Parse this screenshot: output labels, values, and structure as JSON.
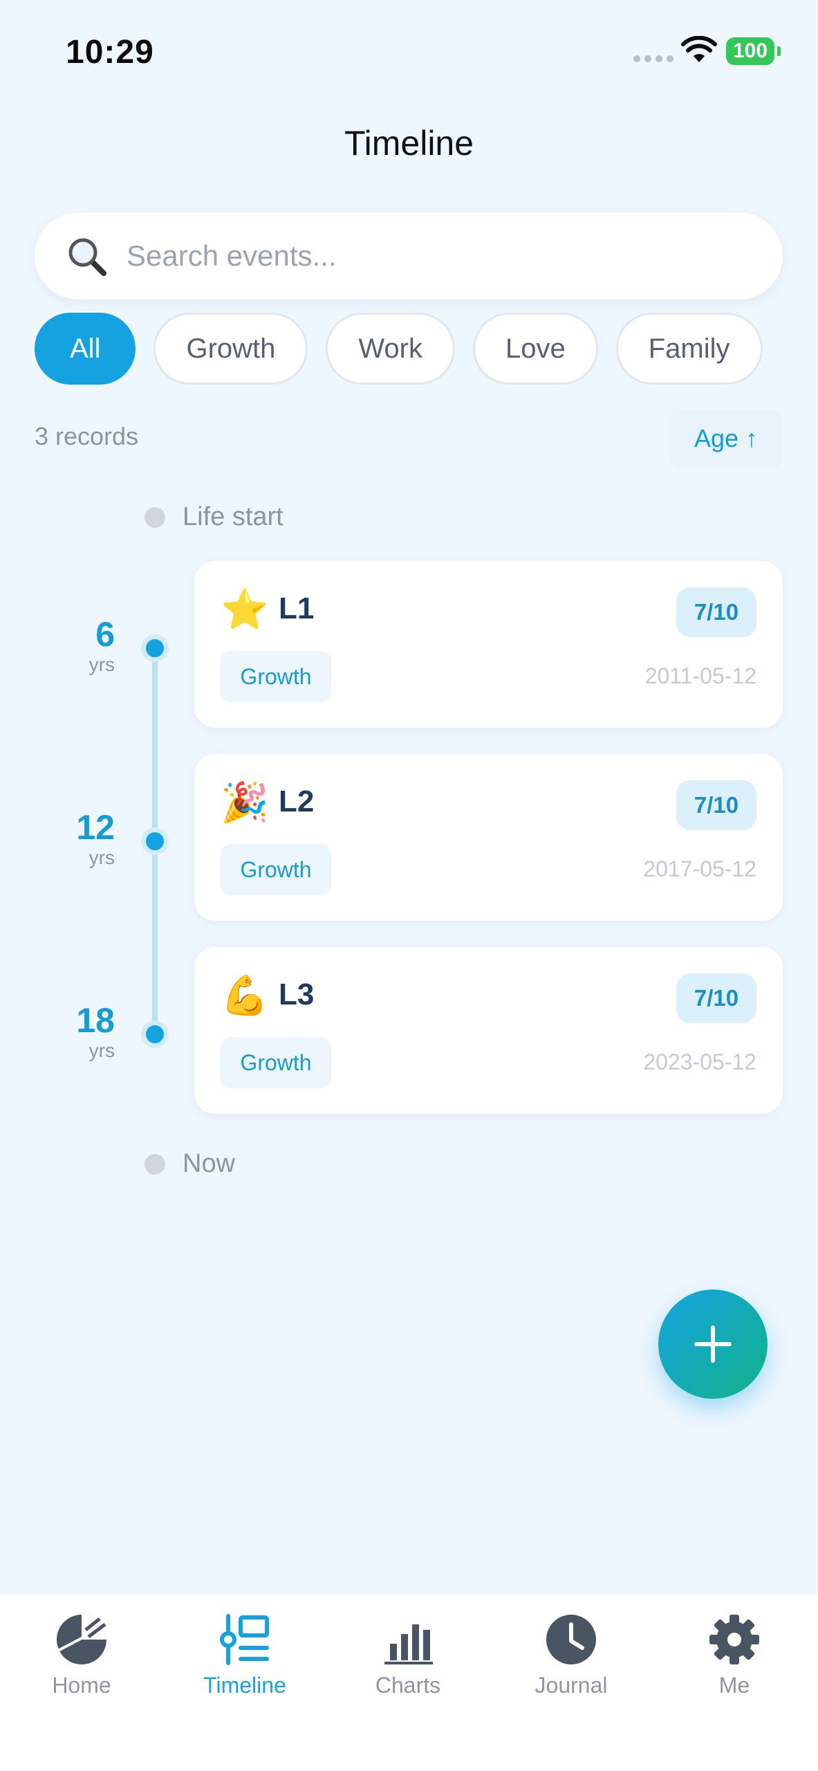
{
  "status_bar": {
    "time": "10:29",
    "battery": "100"
  },
  "header": {
    "title": "Timeline"
  },
  "search": {
    "placeholder": "Search events..."
  },
  "filters": [
    {
      "label": "All",
      "active": true
    },
    {
      "label": "Growth",
      "active": false
    },
    {
      "label": "Work",
      "active": false
    },
    {
      "label": "Love",
      "active": false
    },
    {
      "label": "Family",
      "active": false
    }
  ],
  "list_meta": {
    "records": "3 records",
    "sort_label": "Age ↑"
  },
  "timeline": {
    "start_label": "Life start",
    "end_label": "Now",
    "events": [
      {
        "age": "6",
        "unit": "yrs",
        "emoji": "⭐",
        "title": "L1",
        "score": "7/10",
        "category": "Growth",
        "date": "2011-05-12"
      },
      {
        "age": "12",
        "unit": "yrs",
        "emoji": "🎉",
        "title": "L2",
        "score": "7/10",
        "category": "Growth",
        "date": "2017-05-12"
      },
      {
        "age": "18",
        "unit": "yrs",
        "emoji": "💪",
        "title": "L3",
        "score": "7/10",
        "category": "Growth",
        "date": "2023-05-12"
      }
    ]
  },
  "bottom_nav": [
    {
      "label": "Home",
      "icon": "home-pie-icon",
      "active": false
    },
    {
      "label": "Timeline",
      "icon": "timeline-icon",
      "active": true
    },
    {
      "label": "Charts",
      "icon": "bar-chart-icon",
      "active": false
    },
    {
      "label": "Journal",
      "icon": "clock-icon",
      "active": false
    },
    {
      "label": "Me",
      "icon": "gear-icon",
      "active": false
    }
  ],
  "colors": {
    "accent": "#14A3E0",
    "background": "#EEF6FE",
    "fab_gradient_end": "#12B38A"
  }
}
